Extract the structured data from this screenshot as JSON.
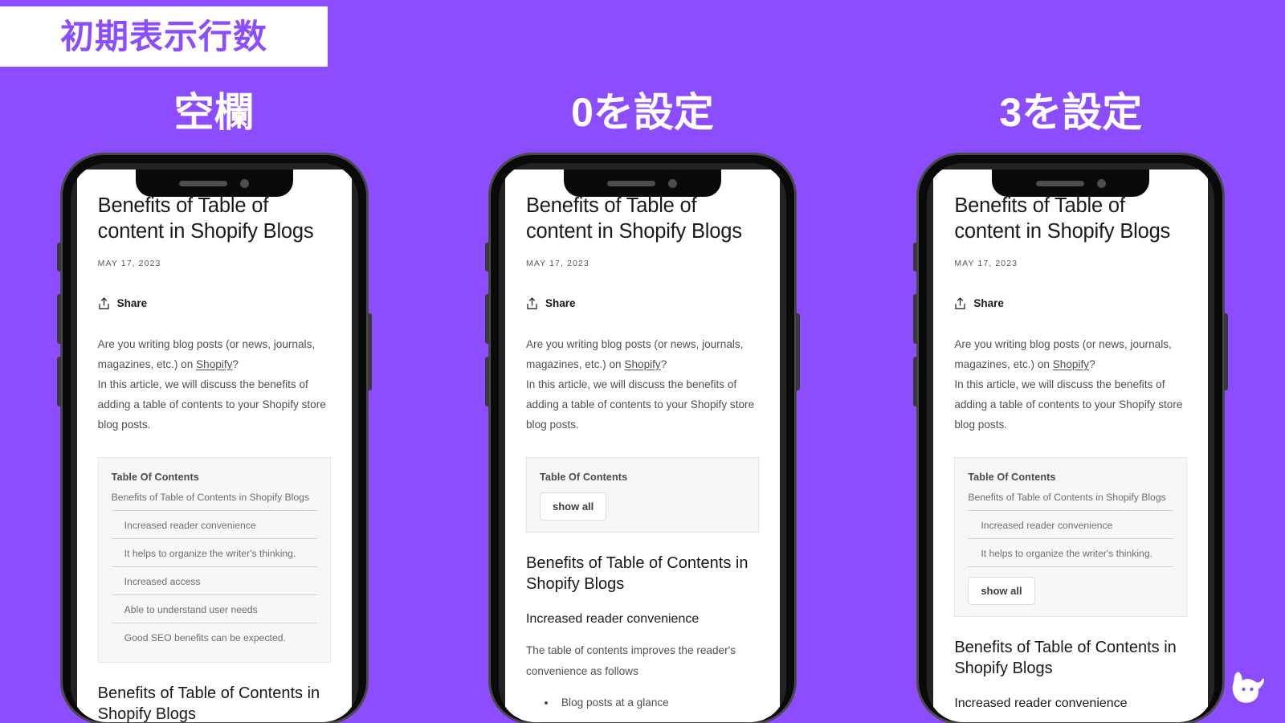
{
  "badge": {
    "label": "初期表示行数"
  },
  "columns": [
    {
      "caption": "空欄"
    },
    {
      "caption": "0を設定"
    },
    {
      "caption": "3を設定"
    }
  ],
  "colors": {
    "background": "#8b4dff",
    "badge_text": "#8b4dff",
    "badge_bg": "#ffffff",
    "caption_text": "#ffffff",
    "phone_frame": "#0a0a0a",
    "toc_bg": "#f7f7f7",
    "toc_border": "#e6e6e6"
  },
  "article": {
    "title": "Benefits of Table of content in Shopify Blogs",
    "date": "MAY 17, 2023",
    "share_label": "Share",
    "share_icon": "share-upload-icon",
    "paragraph_1_part_1": "Are you writing blog posts (or news, journals, magazines, etc.) on ",
    "paragraph_1_link": "Shopify",
    "paragraph_1_part_2": "?",
    "paragraph_2": "In this article, we will discuss the benefits of adding a table of contents to your Shopify store blog posts."
  },
  "toc": {
    "title": "Table Of Contents",
    "show_all_label": "show all",
    "all_items": [
      {
        "text": "Benefits of Table of Contents in Shopify Blogs",
        "level": 1
      },
      {
        "text": "Increased reader convenience",
        "level": 2
      },
      {
        "text": "It helps to organize the writer's thinking.",
        "level": 2
      },
      {
        "text": "Increased access",
        "level": 2
      },
      {
        "text": "Able to understand user needs",
        "level": 2
      },
      {
        "text": "Good SEO benefits can be expected.",
        "level": 2
      }
    ],
    "three_items": [
      {
        "text": "Benefits of Table of Contents in Shopify Blogs",
        "level": 1
      },
      {
        "text": "Increased reader convenience",
        "level": 2
      },
      {
        "text": "It helps to organize the writer's thinking.",
        "level": 2
      }
    ]
  },
  "sections": {
    "h2": "Benefits of Table of Contents in Shopify Blogs",
    "h3": "Increased reader convenience",
    "paragraph": "The table of contents improves the reader's convenience as follows",
    "bullets": [
      "Blog posts at a glance"
    ]
  },
  "phone_chrome": {
    "notch_speaker": "speaker-bar",
    "notch_camera": "front-camera",
    "buttons": [
      "mute-switch",
      "volume-up",
      "volume-down",
      "power"
    ]
  },
  "watermark": {
    "name": "dog-head-logo"
  }
}
